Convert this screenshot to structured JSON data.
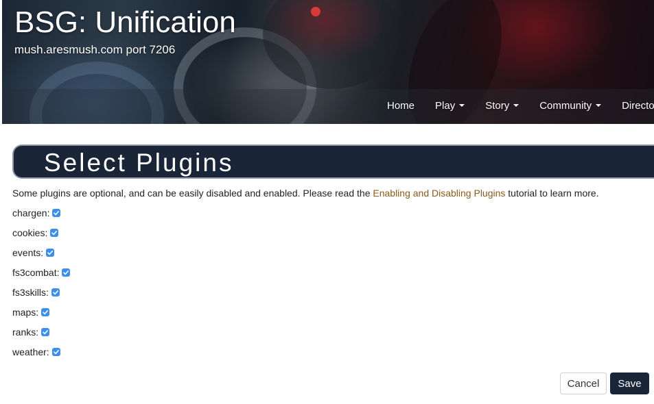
{
  "header": {
    "site_title": "BSG: Unification",
    "site_subtitle": "mush.aresmush.com port 7206"
  },
  "nav": [
    {
      "label": "Home",
      "dropdown": false
    },
    {
      "label": "Play",
      "dropdown": true
    },
    {
      "label": "Story",
      "dropdown": true
    },
    {
      "label": "Community",
      "dropdown": true
    },
    {
      "label": "Directory",
      "dropdown": false
    }
  ],
  "page": {
    "title": "Select Plugins",
    "intro_before": "Some plugins are optional, and can be easily disabled and enabled. Please read the ",
    "intro_link": "Enabling and Disabling Plugins",
    "intro_after": " tutorial to learn more."
  },
  "plugins": [
    {
      "label": "chargen:",
      "checked": true
    },
    {
      "label": "cookies:",
      "checked": true
    },
    {
      "label": "events:",
      "checked": true
    },
    {
      "label": "fs3combat:",
      "checked": true
    },
    {
      "label": "fs3skills:",
      "checked": true
    },
    {
      "label": "maps:",
      "checked": true
    },
    {
      "label": "ranks:",
      "checked": true
    },
    {
      "label": "weather:",
      "checked": true
    }
  ],
  "actions": {
    "cancel_label": "Cancel",
    "save_label": "Save"
  },
  "colors": {
    "heading_bg": "#1a2638",
    "link": "#8a5a1e",
    "checkbox": "#3d8fee"
  }
}
